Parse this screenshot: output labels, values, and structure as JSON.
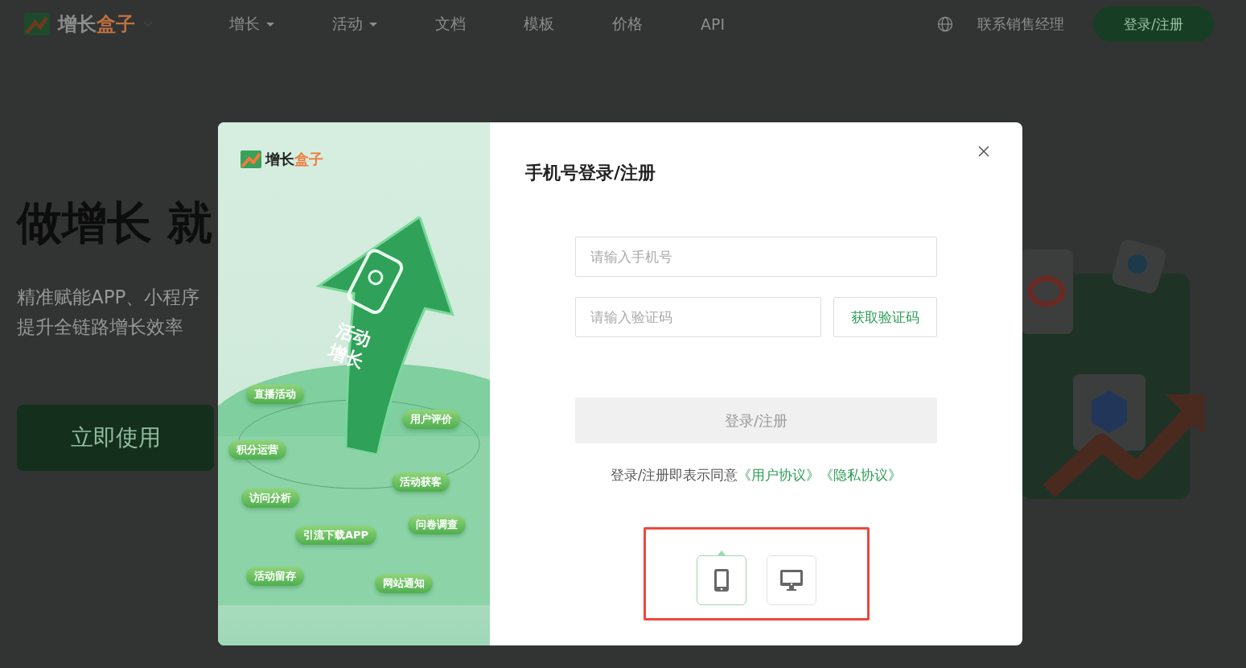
{
  "header": {
    "logo_parts": [
      "增长",
      "盒子"
    ],
    "nav": [
      {
        "label": "增长",
        "has_dropdown": true
      },
      {
        "label": "活动",
        "has_dropdown": true
      },
      {
        "label": "文档",
        "has_dropdown": false
      },
      {
        "label": "模板",
        "has_dropdown": false
      },
      {
        "label": "价格",
        "has_dropdown": false
      },
      {
        "label": "API",
        "has_dropdown": false
      }
    ],
    "contact": "联系销售经理",
    "login_button": "登录/注册"
  },
  "hero": {
    "title": "做增长 就",
    "subtitle_lines": [
      "精准赋能APP、小程序",
      "提升全链路增长效率"
    ],
    "cta": "立即使用"
  },
  "modal": {
    "promo": {
      "logo_parts": [
        "增长",
        "盒子"
      ],
      "arrow_lines": [
        "活动",
        "增长"
      ],
      "tags": [
        "直播活动",
        "用户评价",
        "积分运营",
        "活动获客",
        "访问分析",
        "问卷调查",
        "引流下载APP",
        "活动留存",
        "网站通知"
      ]
    },
    "title": "手机号登录/注册",
    "phone_field": {
      "placeholder": "请输入手机号"
    },
    "code_field": {
      "placeholder": "请输入验证码"
    },
    "get_code_button": "获取验证码",
    "submit": {
      "label": "登录/注册",
      "disabled": true
    },
    "agreement": {
      "text": "登录/注册即表示同意",
      "links": [
        "《用户协议》",
        "《隐私协议》"
      ]
    },
    "device_tabs": [
      {
        "kind": "mobile",
        "selected": true
      },
      {
        "kind": "desktop",
        "selected": false
      }
    ]
  }
}
